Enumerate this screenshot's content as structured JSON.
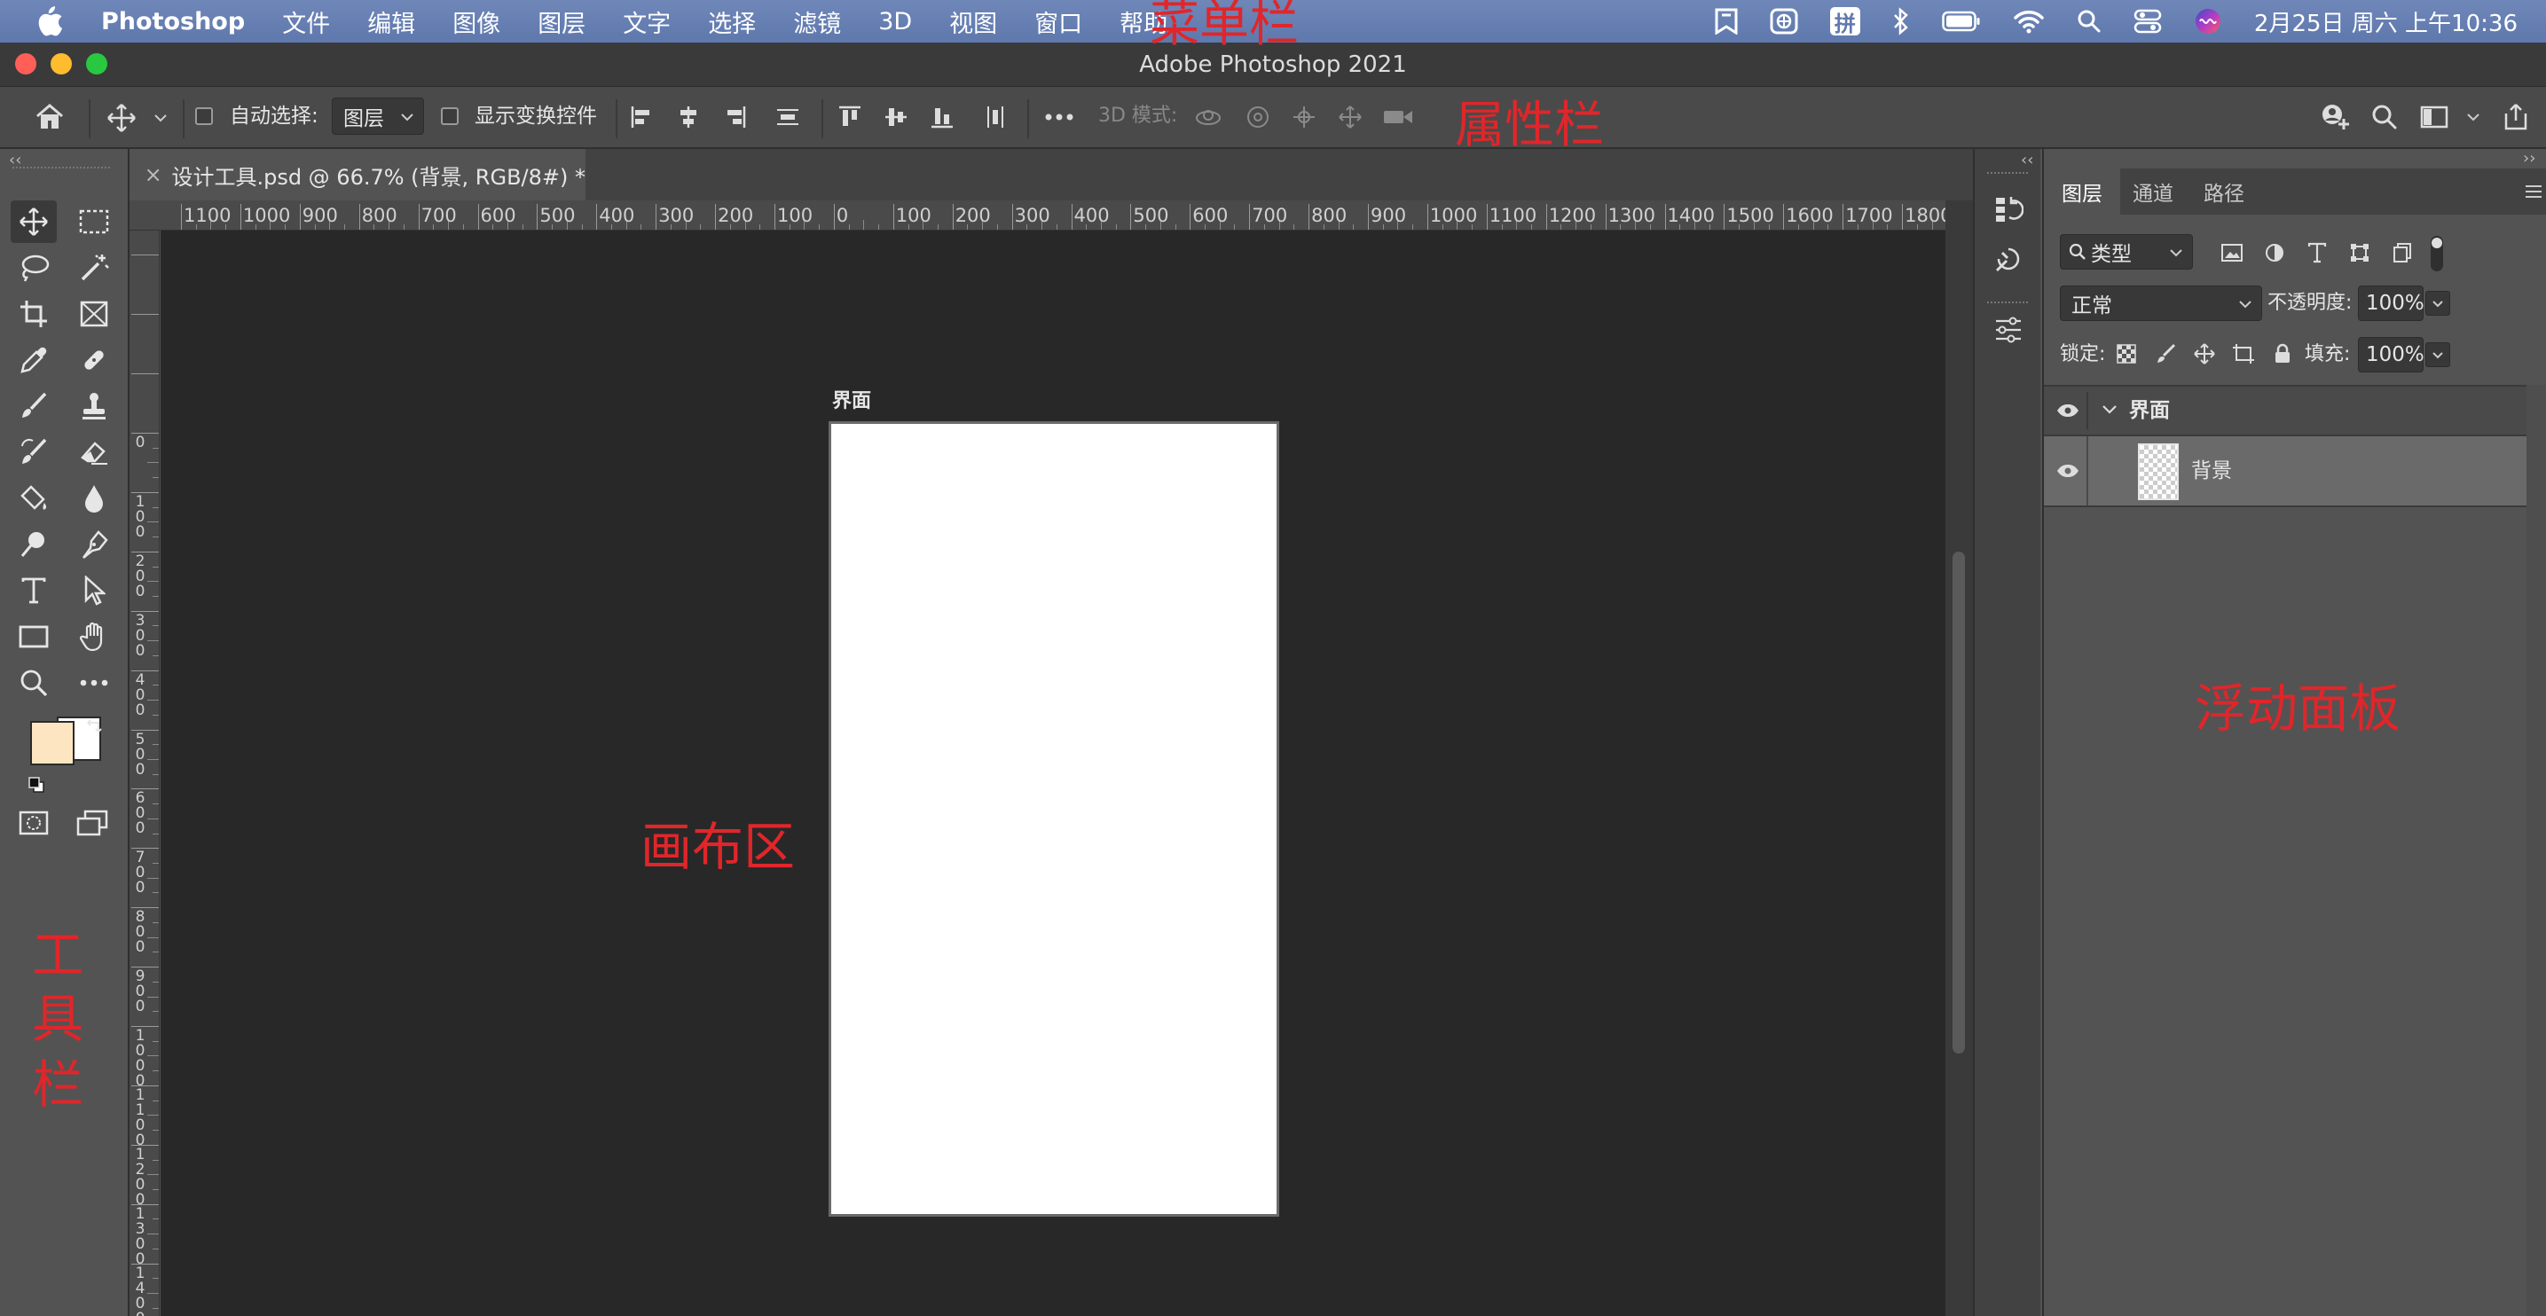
{
  "menubar": {
    "app_name": "Photoshop",
    "items": [
      "文件",
      "编辑",
      "图像",
      "图层",
      "文字",
      "选择",
      "滤镜",
      "3D",
      "视图",
      "窗口",
      "帮助"
    ],
    "input_method": "拼",
    "datetime": "2月25日 周六 上午10:36"
  },
  "window": {
    "title": "Adobe Photoshop 2021"
  },
  "options_bar": {
    "auto_select_label": "自动选择:",
    "auto_select_value": "图层",
    "show_transform_label": "显示变换控件",
    "mode_3d_label": "3D 模式:"
  },
  "document": {
    "tab_title": "设计工具.psd @ 66.7% (背景, RGB/8#) *",
    "artboard_name": "界面"
  },
  "rulers": {
    "h_ticks": [
      "1100",
      "1000",
      "900",
      "800",
      "700",
      "600",
      "500",
      "400",
      "300",
      "200",
      "100",
      "0",
      "100",
      "200",
      "300",
      "400",
      "500",
      "600",
      "700",
      "800",
      "900",
      "1000",
      "1100",
      "1200",
      "1300",
      "1400",
      "1500",
      "1600",
      "1700",
      "1800"
    ],
    "v_ticks": [
      "0",
      "100",
      "200",
      "300",
      "400",
      "500",
      "600",
      "700",
      "800",
      "900",
      "1000",
      "1100",
      "1200",
      "1300",
      "1400"
    ]
  },
  "layers_panel": {
    "tabs": [
      "图层",
      "通道",
      "路径"
    ],
    "filter_kind": "类型",
    "blend_mode": "正常",
    "opacity_label": "不透明度:",
    "opacity_value": "100%",
    "lock_label": "锁定:",
    "fill_label": "填充:",
    "fill_value": "100%",
    "layers": [
      {
        "name": "界面",
        "type": "group",
        "expanded": true
      },
      {
        "name": "背景",
        "type": "layer",
        "selected": true
      }
    ]
  },
  "annotations": {
    "menubar": "菜单栏",
    "options": "属性栏",
    "canvas": "画布区",
    "panels": "浮动面板",
    "toolbar": [
      "工",
      "具",
      "栏"
    ]
  },
  "colors": {
    "foreground": "#fde5c2",
    "background": "#ffffff",
    "annotation": "#e0262a"
  }
}
